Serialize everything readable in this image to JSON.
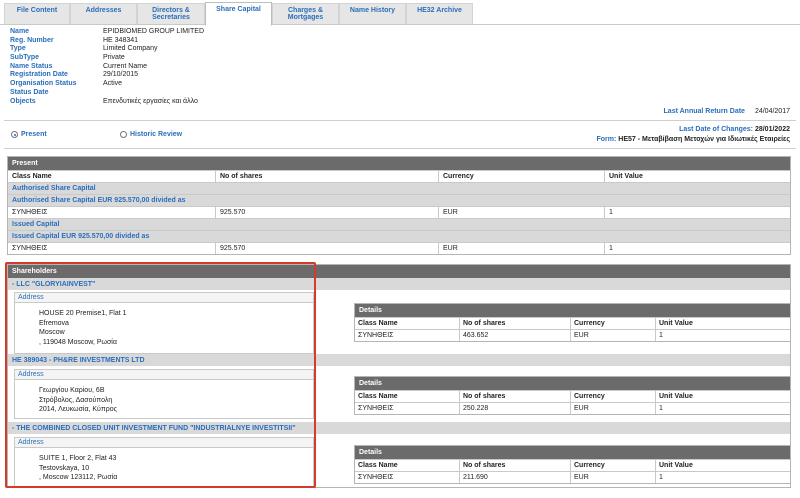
{
  "tabs": [
    {
      "label": "File Content"
    },
    {
      "label": "Addresses"
    },
    {
      "label": "Directors & Secretaries"
    },
    {
      "label": "Share Capital"
    },
    {
      "label": "Charges & Mortgages"
    },
    {
      "label": "Name History"
    },
    {
      "label": "HE32 Archive"
    }
  ],
  "info": {
    "name_label": "Name",
    "name": "EPIDBIOMED GROUP LIMITED",
    "reg_label": "Reg. Number",
    "reg": "HE 348341",
    "type_label": "Type",
    "type": "Limited Company",
    "subtype_label": "SubType",
    "subtype": "Private",
    "name_status_label": "Name Status",
    "name_status": "Current Name",
    "reg_date_label": "Registration Date",
    "reg_date": "29/10/2015",
    "org_status_label": "Organisation Status",
    "org_status": "Active",
    "status_date_label": "Status Date",
    "status_date": "",
    "objects_label": "Objects",
    "objects": "Επενδυτικές εργασίες και άλλο",
    "lar_label": "Last Annual Return Date",
    "lar": "24/04/2017"
  },
  "view": {
    "present_label": "Present",
    "historic_label": "Historic Review",
    "last_changes_label": "Last Date of Changes:",
    "last_changes": "28/01/2022",
    "form_label": "Form:",
    "form": "HE57 - Μεταβίβαση Μετοχών για Ιδιωτικές Εταιρείες"
  },
  "present": {
    "title": "Present",
    "headers": [
      "Class Name",
      "No of shares",
      "Currency",
      "Unit Value"
    ],
    "authorised_title": "Authorised Share Capital",
    "authorised_desc": "Authorised Share Capital EUR 925.570,00 divided as",
    "authorised_row": [
      "ΣΥΝΗΘΕΙΣ",
      "925.570",
      "EUR",
      "1"
    ],
    "issued_title": "Issued Capital",
    "issued_desc": "Issued Capital EUR 925.570,00 divided as",
    "issued_row": [
      "ΣΥΝΗΘΕΙΣ",
      "925.570",
      "EUR",
      "1"
    ]
  },
  "shareholders": {
    "title": "Shareholders",
    "address_label": "Address",
    "details_label": "Details",
    "headers": [
      "Class Name",
      "No of shares",
      "Currency",
      "Unit Value"
    ],
    "holders": [
      {
        "name": "- LLC \"GLORYIAINVEST\"",
        "address": [
          "HOUSE 20 Premise1, Flat 1",
          "Efremova",
          "Moscow",
          ", 119048 Moscow, Ρωσία"
        ],
        "row": [
          "ΣΥΝΗΘΕΙΣ",
          "463.652",
          "EUR",
          "1"
        ]
      },
      {
        "name": "HE 389043 - PH&RE INVESTMENTS LTD",
        "address": [
          "Γεωργίου Καρίου, 6B",
          "Στρόβολος, Δασούπολη",
          "2014, Λευκωσία, Κύπρος"
        ],
        "row": [
          "ΣΥΝΗΘΕΙΣ",
          "250.228",
          "EUR",
          "1"
        ]
      },
      {
        "name": "- THE COMBINED CLOSED UNIT INVESTMENT FUND \"INDUSTRIALNYE INVESTITSII\"",
        "address": [
          "SUITE 1, Floor 2, Flat 43",
          "Testovskaya, 10",
          ", Moscow 123112, Ρωσία"
        ],
        "row": [
          "ΣΥΝΗΘΕΙΣ",
          "211.690",
          "EUR",
          "1"
        ]
      }
    ]
  },
  "colors": {
    "accent": "#2a6ebb",
    "header_bg": "#6b6b6b",
    "section_bg": "#d9d9d9",
    "highlight": "#d33b2c"
  }
}
